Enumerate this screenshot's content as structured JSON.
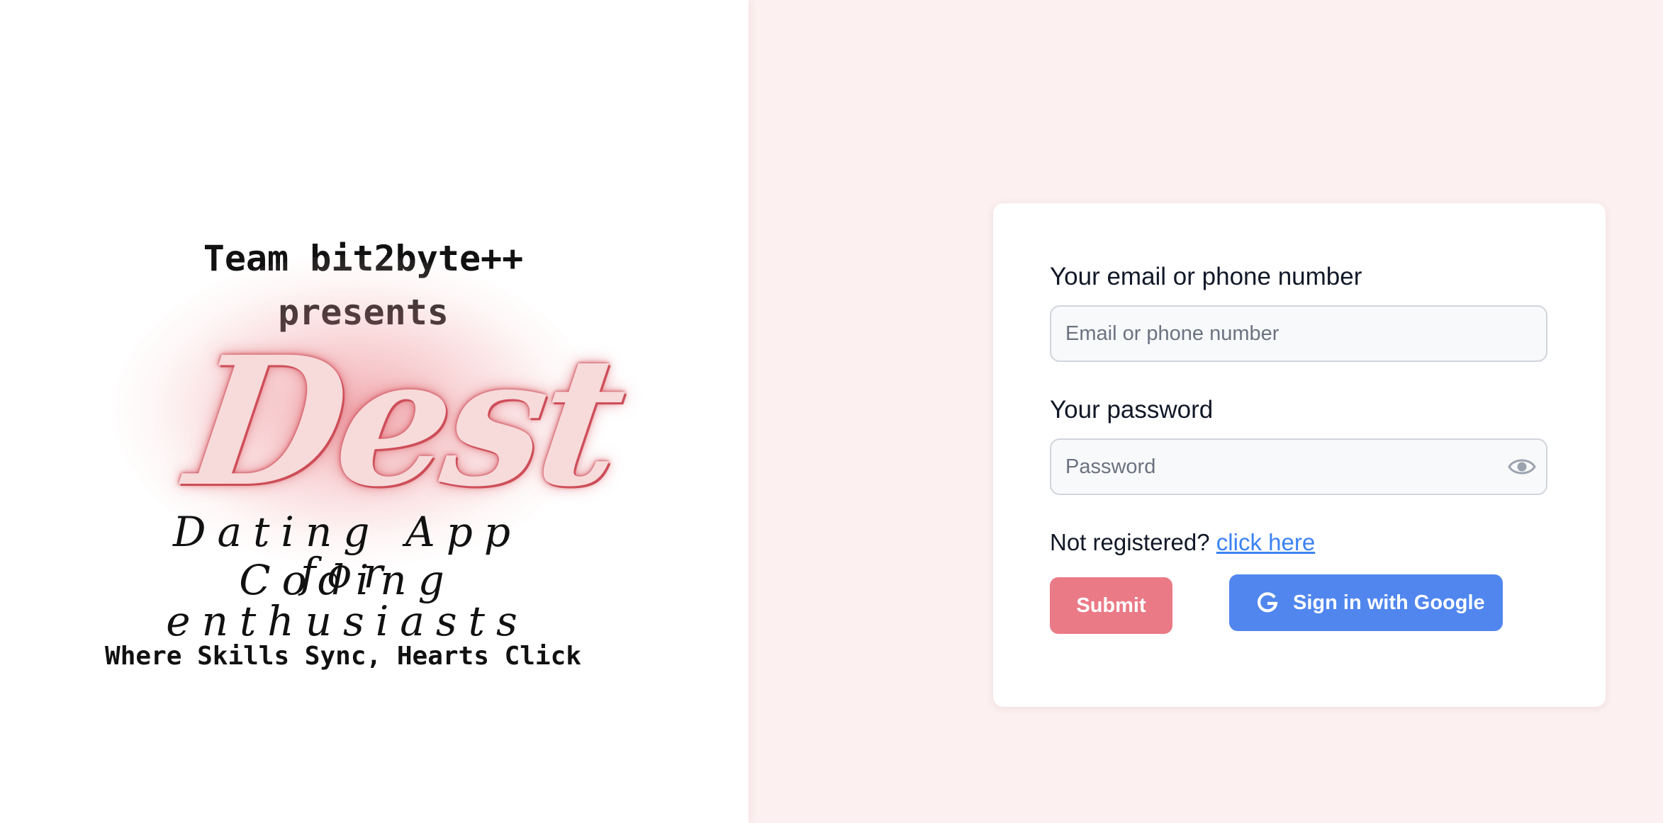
{
  "brand": {
    "team_line": "Team bit2byte++",
    "presents_line": "presents",
    "logo_text": "Dest",
    "tagline_line1": "Dating App for",
    "tagline_line2": "Coding enthusiasts",
    "motto": "Where Skills Sync, Hearts Click",
    "glow_color": "#e86e78"
  },
  "login_form": {
    "email_label": "Your email or phone number",
    "email_placeholder": "Email or phone number",
    "email_value": "",
    "password_label": "Your password",
    "password_placeholder": "Password",
    "password_value": "",
    "password_toggle_icon": "eye-icon",
    "register_prompt": "Not registered?",
    "register_link": "click here",
    "submit_label": "Submit",
    "google_icon": "google-icon",
    "google_label": "Sign in with Google"
  },
  "colors": {
    "right_background": "#fcf0f0",
    "submit_button": "#ea7a86",
    "google_button": "#5086ee",
    "link": "#3b82f6"
  }
}
